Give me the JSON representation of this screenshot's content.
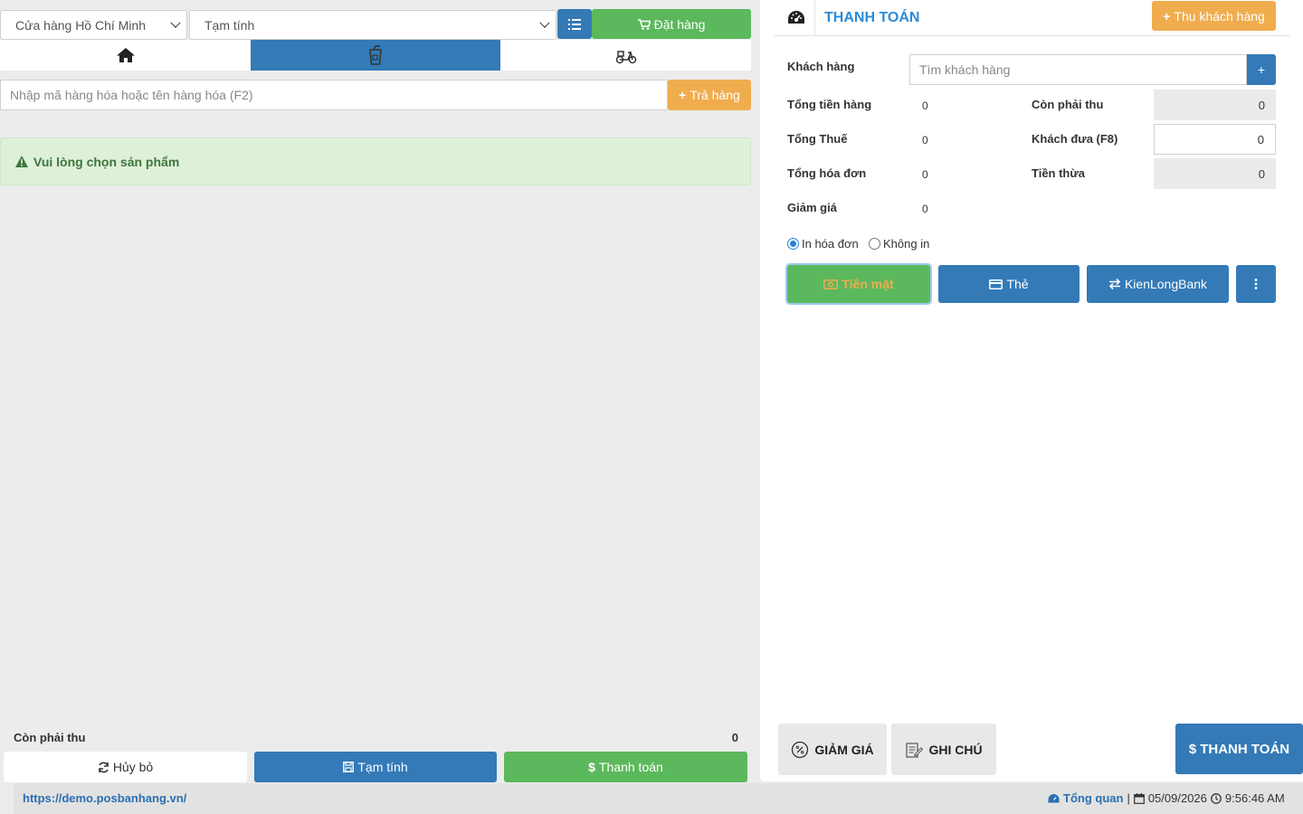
{
  "left": {
    "store_select": "Cửa hàng Hồ Chí Minh",
    "mode_select": "Tạm tính",
    "order_button": "Đặt hàng",
    "search_placeholder": "Nhập mã hàng hóa hoặc tên hàng hóa (F2)",
    "return_button": "Trả hàng",
    "alert_text": "Vui lòng chọn sản phẩm",
    "footer": {
      "remaining_label": "Còn phải thu",
      "remaining_value": "0",
      "cancel_button": "Hủy bỏ",
      "draft_button": "Tạm tính",
      "pay_button": "Thanh toán"
    }
  },
  "right": {
    "title": "THANH TOÁN",
    "collect_button": "Thu khách hàng",
    "customer_label": "Khách hàng",
    "customer_placeholder": "Tìm khách hàng",
    "add_customer": "+",
    "summary": [
      {
        "label": "Tổng tiền hàng",
        "value": "0"
      },
      {
        "label": "Tổng Thuế",
        "value": "0"
      },
      {
        "label": "Tổng hóa đơn",
        "value": "0"
      },
      {
        "label": "Giảm giá",
        "value": "0"
      }
    ],
    "payment": {
      "remaining_label": "Còn phải thu",
      "remaining_value": "0",
      "given_label": "Khách đưa (F8)",
      "given_value": "0",
      "change_label": "Tiền thừa",
      "change_value": "0"
    },
    "print_option": "In hóa đơn",
    "no_print_option": "Không in",
    "methods": {
      "cash": "Tiền mặt",
      "card": "Thẻ",
      "bank": "KienLongBank"
    },
    "discount_button": "GIẢM GIÁ",
    "note_button": "GHI CHÚ",
    "checkout_button": "THANH TOÁN"
  },
  "status": {
    "url": "https://demo.posbanhang.vn/",
    "overview": "Tổng quan",
    "date": "05/09/2026",
    "time": "9:56:46 AM"
  },
  "colors": {
    "green": "#5cb85c",
    "blue": "#337ab7",
    "orange": "#f0ad4e",
    "title_blue": "#2a8bd8"
  }
}
